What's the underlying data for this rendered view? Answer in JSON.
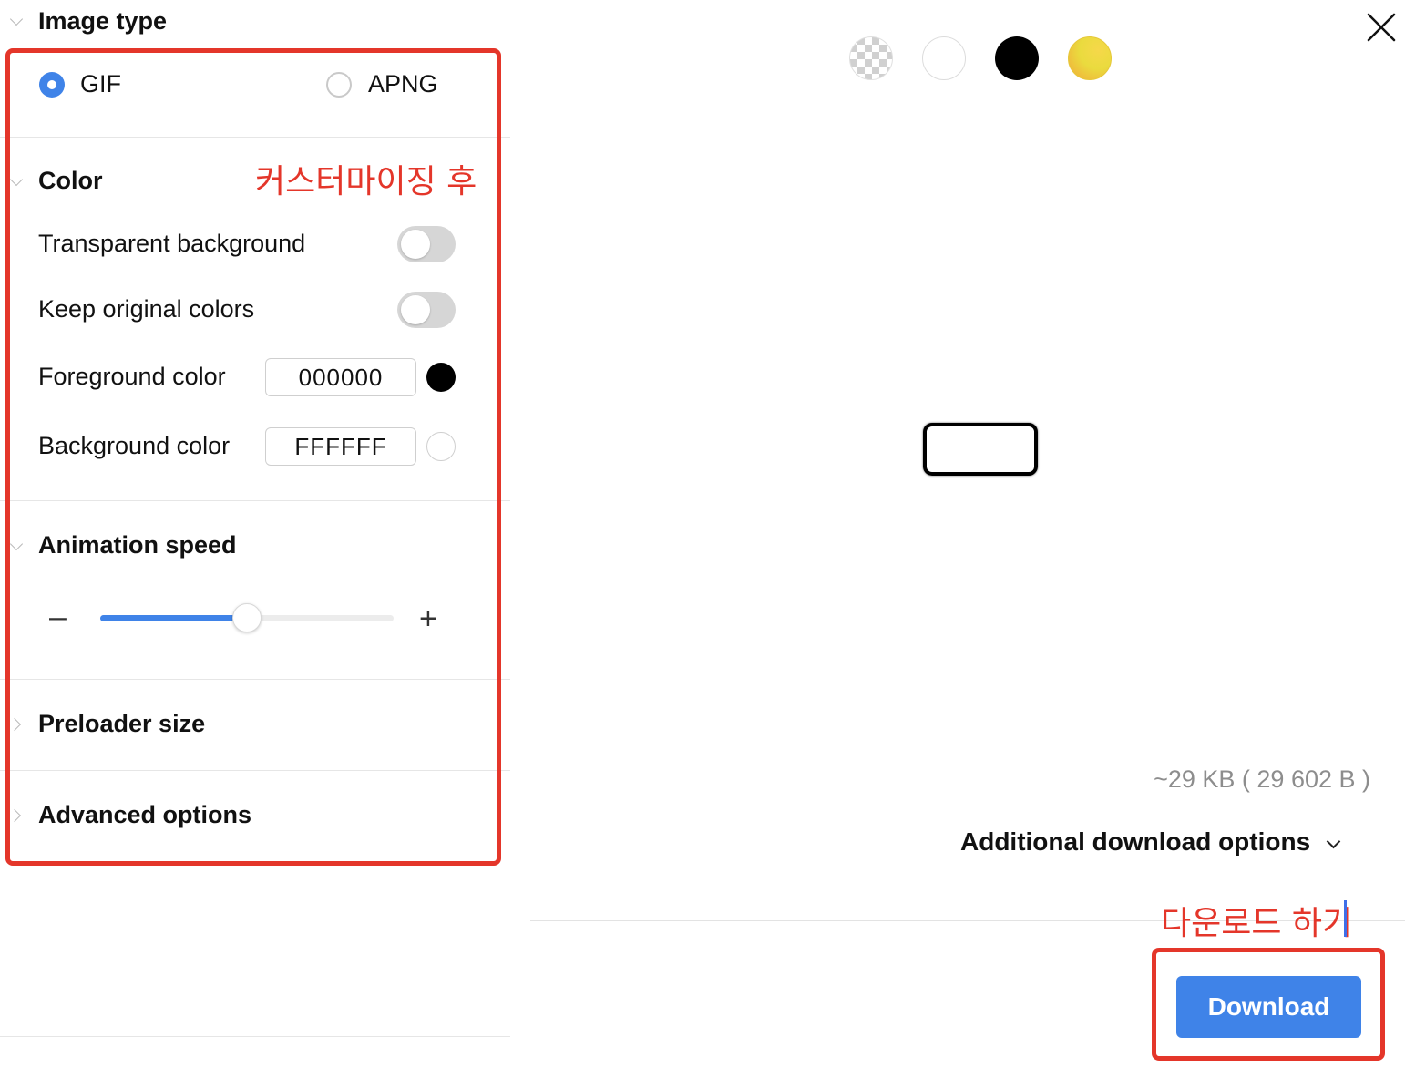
{
  "image_type": {
    "title": "Image type",
    "options": [
      {
        "label": "GIF",
        "selected": true
      },
      {
        "label": "APNG",
        "selected": false
      }
    ]
  },
  "color": {
    "title": "Color",
    "transparent_background": {
      "label": "Transparent background",
      "on": false
    },
    "keep_original_colors": {
      "label": "Keep original colors",
      "on": false
    },
    "foreground": {
      "label": "Foreground color",
      "value": "000000",
      "swatch": "#000000"
    },
    "background": {
      "label": "Background color",
      "value": "FFFFFF",
      "swatch": "#ffffff"
    }
  },
  "animation_speed": {
    "title": "Animation speed",
    "minus": "–",
    "plus": "+",
    "value_fraction": 0.5
  },
  "preloader_size": {
    "title": "Preloader size"
  },
  "advanced_options": {
    "title": "Advanced options"
  },
  "annotations": {
    "after_customizing": "커스터마이징 후",
    "download_label": "다운로드 하기"
  },
  "preview": {
    "background_swatches": [
      {
        "name": "transparent",
        "color": "checker"
      },
      {
        "name": "white",
        "color": "#ffffff"
      },
      {
        "name": "black",
        "color": "#000000"
      },
      {
        "name": "gradient",
        "color": "#f2d436"
      }
    ],
    "file_size": "~29 KB ( 29 602 B )",
    "additional_download_options": "Additional download options",
    "download_button": "Download"
  },
  "colors": {
    "accent": "#3f83e8",
    "annotation_red": "#e4362a"
  }
}
